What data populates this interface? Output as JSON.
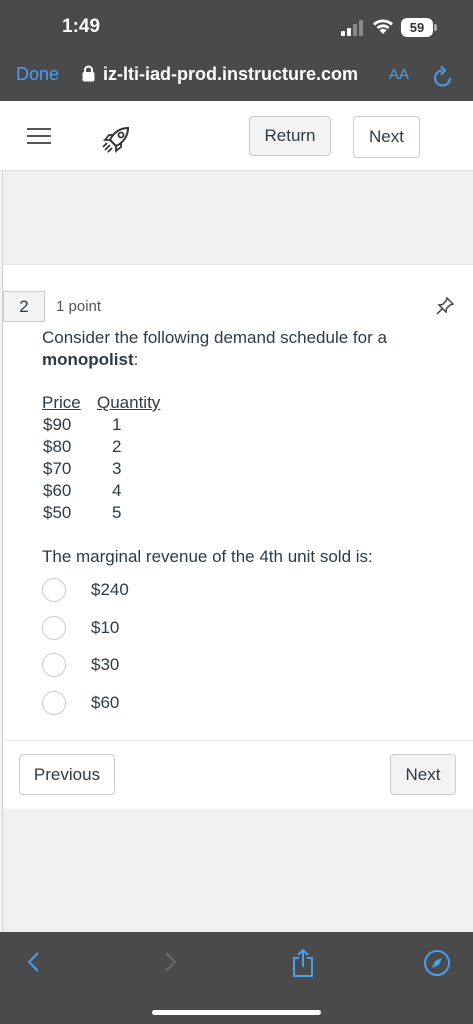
{
  "status_bar": {
    "time": "1:49",
    "battery": "59"
  },
  "browser": {
    "done_label": "Done",
    "url": "iz-lti-iad-prod.instructure.com",
    "text_size_label": "AA"
  },
  "nav": {
    "return_label": "Return",
    "next_label": "Next"
  },
  "question": {
    "number": "2",
    "points": "1 point",
    "prompt_plain": "Consider the following demand schedule for a ",
    "prompt_bold": "monopolist",
    "prompt_end": ":",
    "table": {
      "headers": [
        "Price",
        "Quantity"
      ],
      "rows": [
        [
          "$90",
          "1"
        ],
        [
          "$80",
          "2"
        ],
        [
          "$70",
          "3"
        ],
        [
          "$60",
          "4"
        ],
        [
          "$50",
          "5"
        ]
      ]
    },
    "sub_prompt": "The marginal revenue of the 4th unit sold is:",
    "choices": [
      "$240",
      "$10",
      "$30",
      "$60"
    ]
  },
  "footer": {
    "previous_label": "Previous",
    "next_label": "Next"
  },
  "colors": {
    "chrome": "#4a4a4a",
    "link_blue": "#4a9ff5",
    "text": "#2d3b45"
  }
}
